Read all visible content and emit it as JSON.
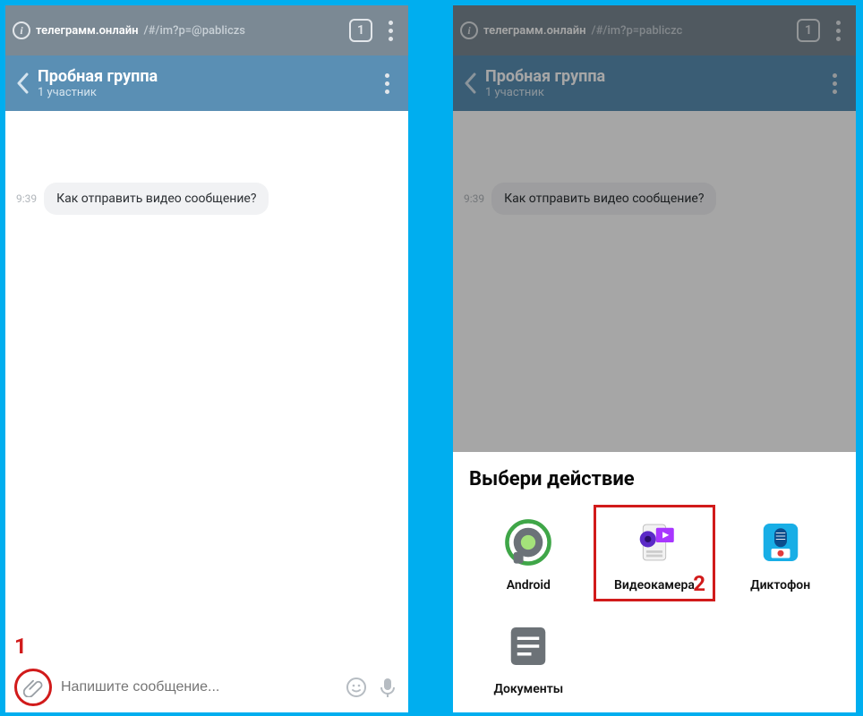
{
  "url": {
    "domain_left": "телеграмм.онлайн",
    "rest_left": "/#/im?p=@pabliczs",
    "domain_right": "телеграмм.онлайн",
    "rest_right": "/#/im?p=pabliczc",
    "tab_count": "1"
  },
  "chat": {
    "title": "Пробная группа",
    "subtitle": "1 участник",
    "message_time": "9:39",
    "message_text": "Как отправить видео сообщение?",
    "input_placeholder": "Напишите сообщение..."
  },
  "sheet": {
    "title": "Выбери действие",
    "items": [
      {
        "label": "Android"
      },
      {
        "label": "Видеокамера"
      },
      {
        "label": "Диктофон"
      },
      {
        "label": "Документы"
      }
    ]
  },
  "annotations": {
    "one": "1",
    "two": "2"
  }
}
